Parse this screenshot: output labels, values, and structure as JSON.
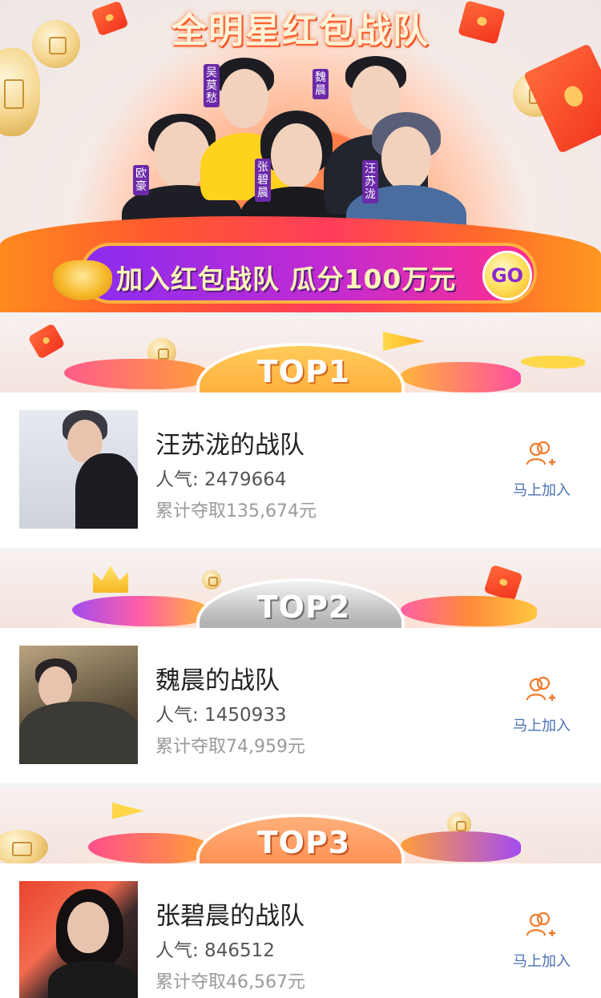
{
  "banner": {
    "title": "全明星红包战队",
    "cta_text": "加入红包战队 瓜分100万元",
    "go_label": "GO",
    "celebrities": [
      {
        "name": "欧豪"
      },
      {
        "name": "吴莫愁"
      },
      {
        "name": "张碧晨"
      },
      {
        "name": "魏晨"
      },
      {
        "name": "汪苏泷"
      }
    ]
  },
  "teams": [
    {
      "rank": "TOP1",
      "name": "汪苏泷的战队",
      "popularity": "人气: 2479664",
      "earned": "累计夺取135,674元",
      "join_label": "马上加入",
      "avatar_icon": "person-photo"
    },
    {
      "rank": "TOP2",
      "name": "魏晨的战队",
      "popularity": "人气: 1450933",
      "earned": "累计夺取74,959元",
      "join_label": "马上加入",
      "avatar_icon": "person-photo"
    },
    {
      "rank": "TOP3",
      "name": "张碧晨的战队",
      "popularity": "人气: 846512",
      "earned": "累计夺取46,567元",
      "join_label": "马上加入",
      "avatar_icon": "person-photo"
    }
  ],
  "colors": {
    "accent_orange": "#ff7a2a",
    "cta_purple": "#8b2cf0",
    "join_blue": "#4a6fb5",
    "join_icon": "#f07a2a"
  }
}
